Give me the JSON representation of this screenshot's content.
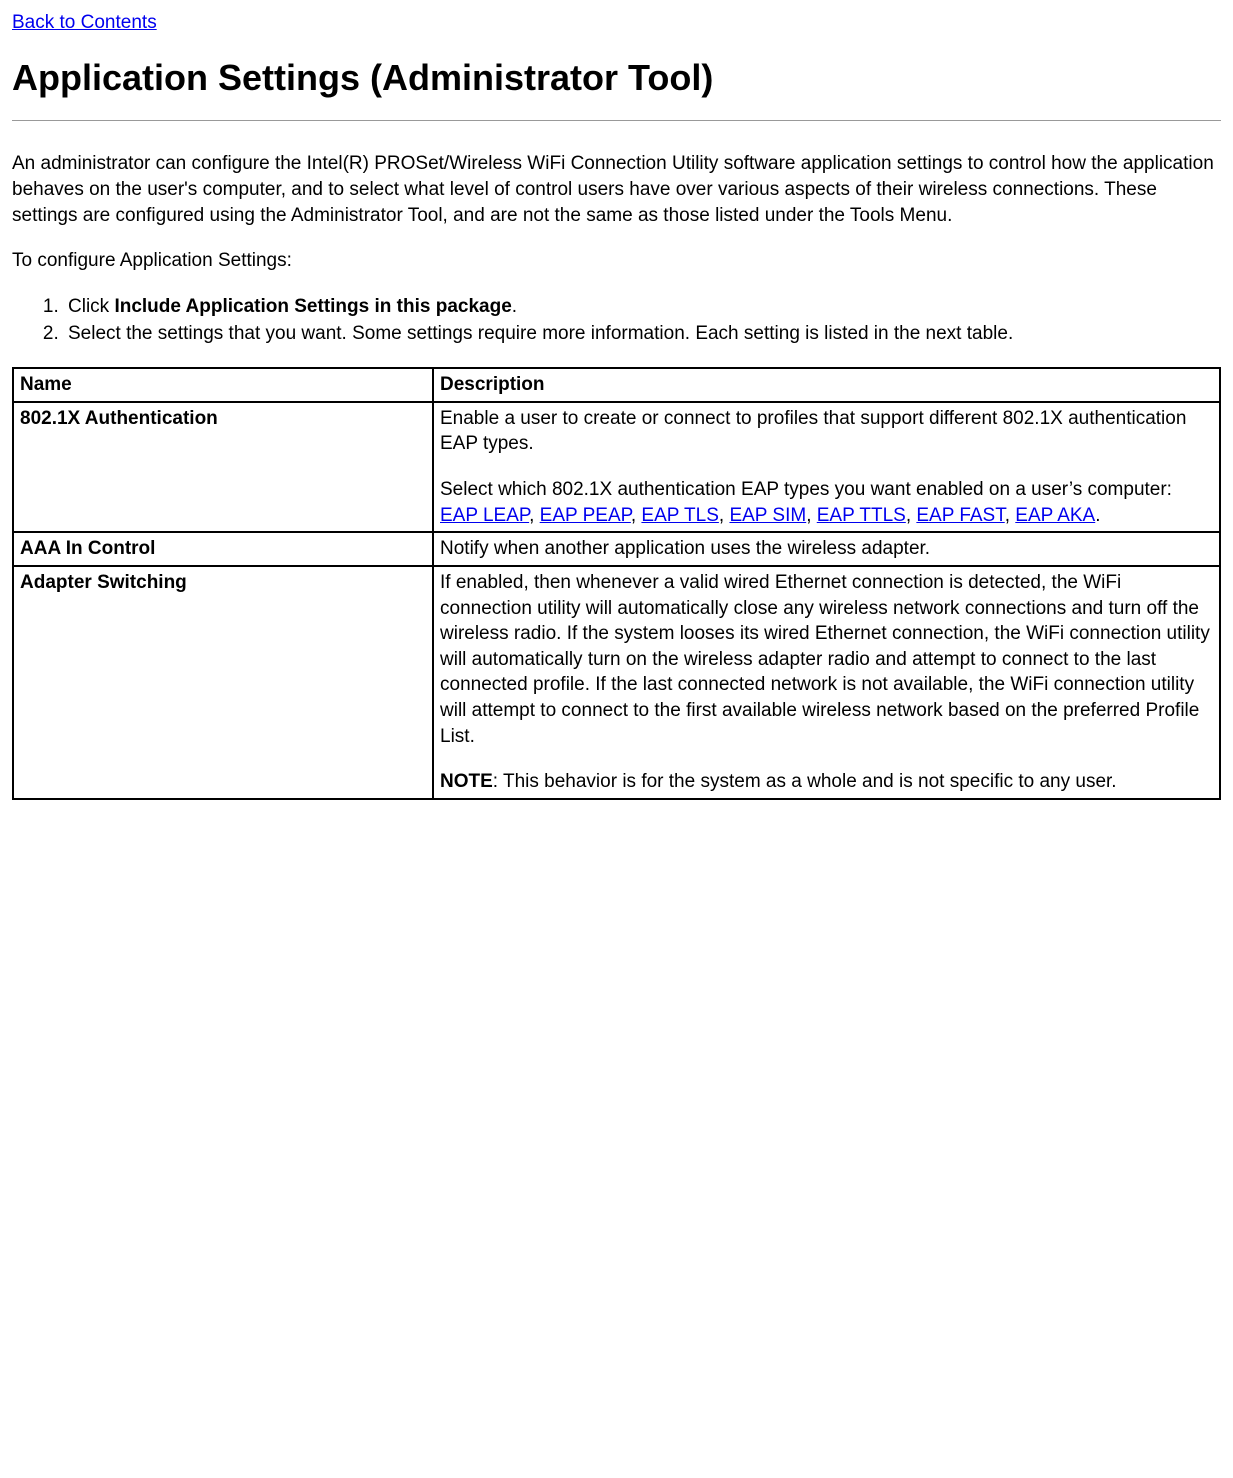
{
  "nav": {
    "back_link": "Back to Contents"
  },
  "heading": "Application Settings (Administrator Tool)",
  "intro_para": "An administrator can configure the Intel(R) PROSet/Wireless WiFi Connection Utility software application settings to control how the application behaves on the user's computer, and to select what level of control users have over various aspects of their wireless connections. These settings are configured using the Administrator Tool, and are not the same as those listed under the Tools Menu.",
  "configure_para": "To configure Application Settings:",
  "step1_pre": "Click ",
  "step1_bold": "Include Application Settings in this package",
  "step1_post": ".",
  "step2": "Select the settings that you want. Some settings require more information. Each setting is listed in the next table.",
  "table": {
    "header": {
      "name": "Name",
      "description": "Description"
    },
    "row1": {
      "name": "802.1X Authentication",
      "desc_p1": "Enable a user to create or connect to profiles that support different 802.1X authentication EAP types.",
      "desc_p2_pre": "Select which 802.1X authentication EAP types you want enabled on a user’s computer: ",
      "links": {
        "eap_leap": "EAP LEAP",
        "eap_peap": "EAP PEAP",
        "eap_tls": "EAP TLS",
        "eap_sim": "EAP SIM",
        "eap_ttls": "EAP TTLS",
        "eap_fast": "EAP FAST",
        "eap_aka": "EAP AKA"
      },
      "sep": ", ",
      "desc_p2_post": "."
    },
    "row2": {
      "name": "AAA In Control",
      "desc": "Notify when another application uses the wireless adapter."
    },
    "row3": {
      "name": "Adapter Switching",
      "desc_p1": "If enabled, then whenever a valid wired Ethernet connection is detected, the WiFi connection utility will automatically close any wireless network connections and turn off the wireless radio. If the system looses its wired Ethernet connection, the WiFi connection utility will automatically turn on the wireless adapter radio and attempt to connect to the last connected profile. If the last connected network is not available, the WiFi connection utility will attempt to connect to the first available wireless network based on the preferred Profile List.",
      "note_label": "NOTE",
      "note_text": ": This behavior is for the system as a whole and is not specific to any user."
    }
  }
}
